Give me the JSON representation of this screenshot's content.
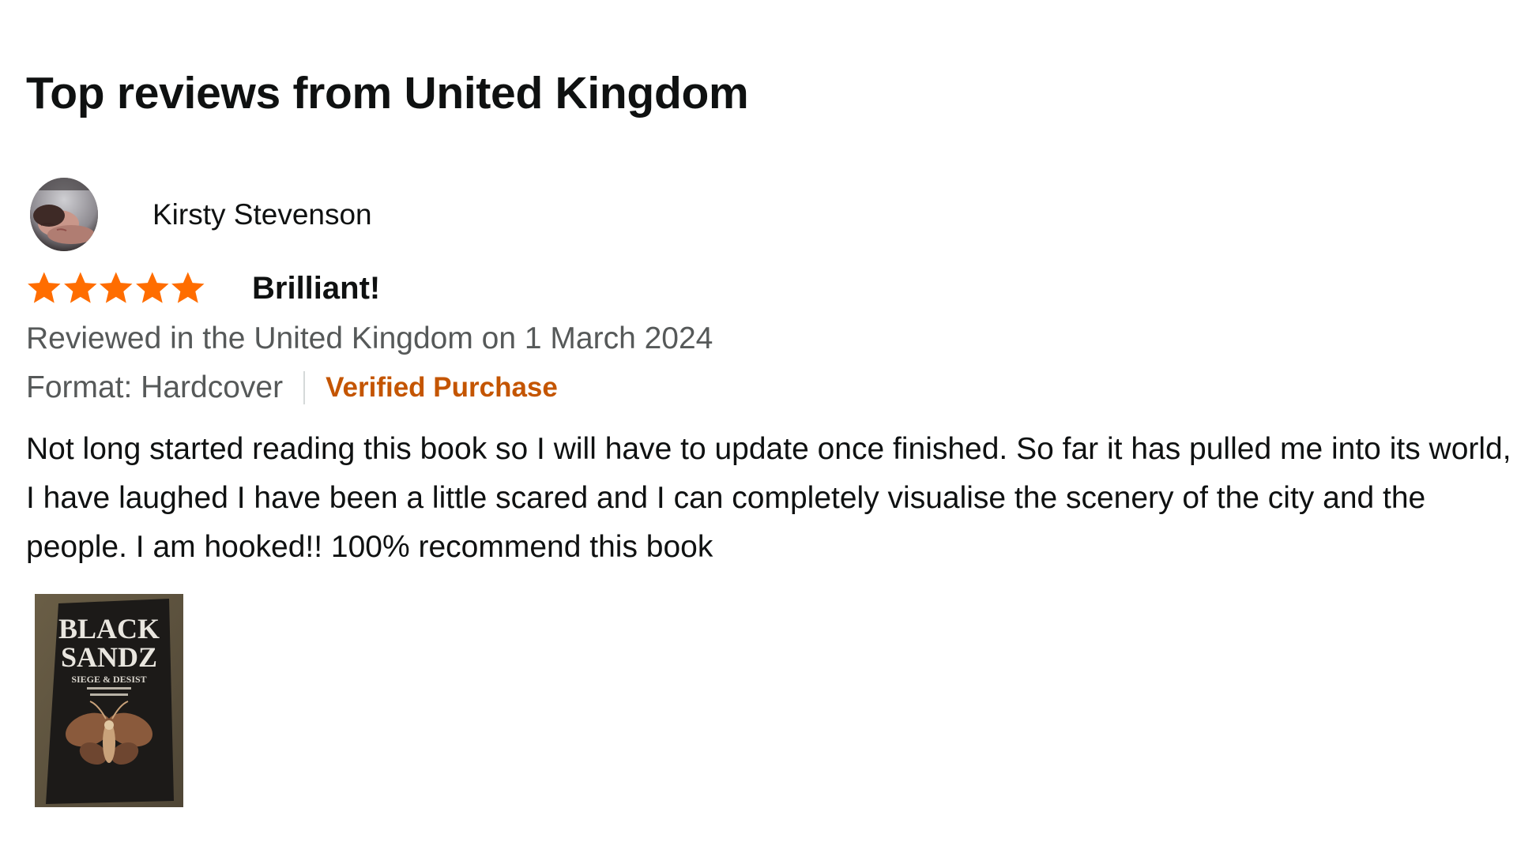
{
  "section": {
    "title": "Top reviews from United Kingdom"
  },
  "review": {
    "reviewer_name": "Kirsty Stevenson",
    "avatar_icon": "profile-photo",
    "rating": 5,
    "rating_max": 5,
    "star_color": "#ff6d00",
    "title": "Brilliant!",
    "date_line": "Reviewed in the United Kingdom on 1 March 2024",
    "format_line": "Format: Hardcover",
    "verified_label": "Verified Purchase",
    "verified_color": "#c45500",
    "body": "Not long started reading this book so I will have to update once finished. So far it has pulled me into its world, I have laughed I have been a little scared and I can completely visualise the scenery of the city and the people. I am hooked!! 100% recommend this book",
    "image": {
      "lines": [
        "BLACK",
        "SANDZ"
      ],
      "subtitle": "SIEGE & DESIST"
    }
  }
}
